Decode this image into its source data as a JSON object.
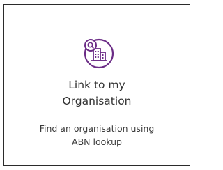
{
  "card": {
    "title_line1": "Link to my",
    "title_line2": "Organisation",
    "description_line1": "Find an organisation using",
    "description_line2": "ABN lookup",
    "icon": "organisation-search-icon"
  },
  "colors": {
    "accent": "#6b2c86",
    "border": "#2b2b2b",
    "text": "#333333"
  }
}
